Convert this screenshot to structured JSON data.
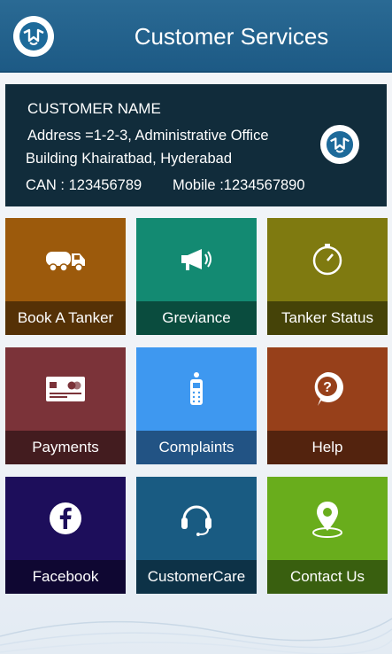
{
  "header": {
    "title": "Customer Services"
  },
  "customer": {
    "name": "CUSTOMER NAME",
    "address_line1": "Address =1-2-3, Administrative Office",
    "address_line2": "Building Khairatbad, Hyderabad",
    "can": "CAN : 123456789",
    "mobile": "Mobile :1234567890"
  },
  "tiles": [
    {
      "label": "Book A Tanker",
      "icon": "tanker-truck-icon",
      "color": "#9c5a0c"
    },
    {
      "label": "Greviance",
      "icon": "megaphone-icon",
      "color": "#138a72"
    },
    {
      "label": "Tanker Status",
      "icon": "stopwatch-icon",
      "color": "#7f7a10"
    },
    {
      "label": "Payments",
      "icon": "credit-card-icon",
      "color": "#7b3339"
    },
    {
      "label": "Complaints",
      "icon": "phone-handset-icon",
      "color": "#3e98f0"
    },
    {
      "label": "Help",
      "icon": "help-question-icon",
      "color": "#97401a"
    },
    {
      "label": "Facebook",
      "icon": "facebook-icon",
      "color": "#1d0e5b"
    },
    {
      "label": "CustomerCare",
      "icon": "headset-icon",
      "color": "#195b82"
    },
    {
      "label": "Contact Us",
      "icon": "location-pin-icon",
      "color": "#69ad1c"
    }
  ]
}
